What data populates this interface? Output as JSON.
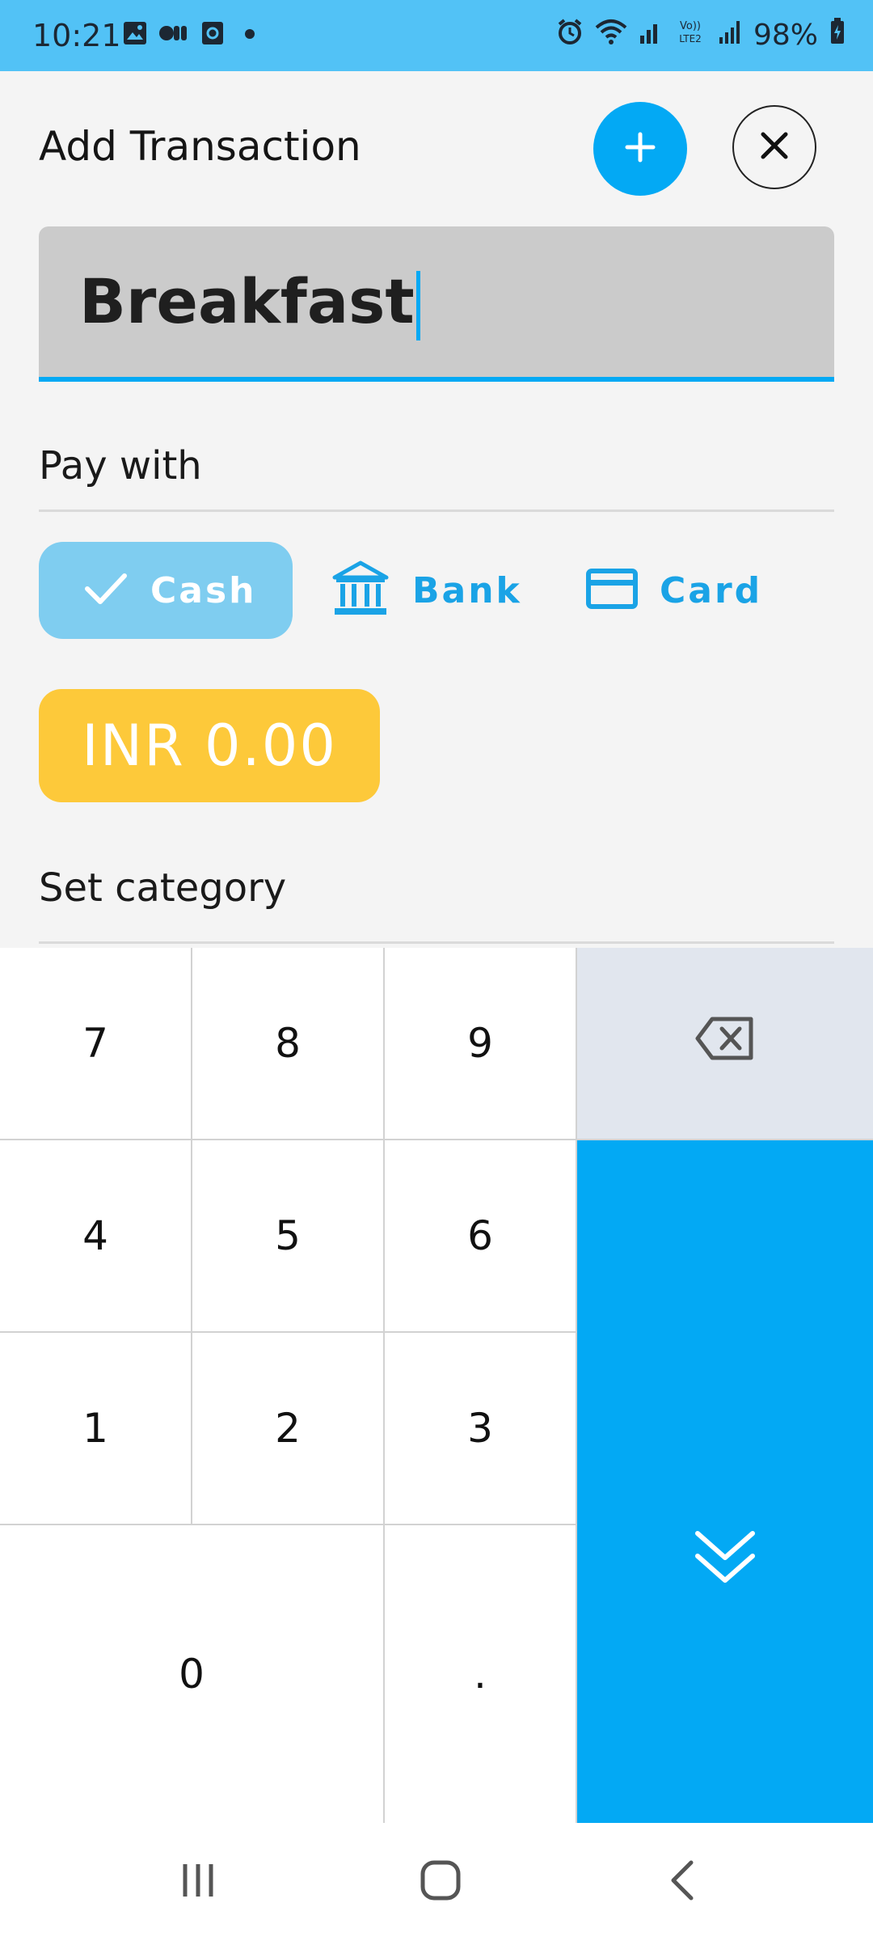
{
  "status_bar": {
    "time": "10:21",
    "battery": "98%",
    "left_icons": [
      "gallery-icon",
      "camera-icon",
      "app-icon",
      "dot-icon"
    ],
    "right_icons": [
      "alarm-icon",
      "wifi-icon",
      "signal-icon",
      "volte-icon",
      "signal-icon",
      "battery-icon"
    ]
  },
  "header": {
    "title": "Add Transaction",
    "add_icon": "plus-icon",
    "close_icon": "close-icon"
  },
  "input": {
    "value": "Breakfast"
  },
  "pay_with": {
    "label": "Pay with",
    "options": [
      {
        "label": "Cash",
        "icon": "check-icon",
        "selected": true
      },
      {
        "label": "Bank",
        "icon": "bank-icon",
        "selected": false
      },
      {
        "label": "Card",
        "icon": "card-icon",
        "selected": false
      }
    ]
  },
  "amount": {
    "text": "INR 0.00"
  },
  "category": {
    "label": "Set category"
  },
  "keypad": {
    "keys": [
      "7",
      "8",
      "9",
      "4",
      "5",
      "6",
      "1",
      "2",
      "3",
      "0",
      "."
    ],
    "backspace_icon": "backspace-icon",
    "done_icon": "double-chevron-down-icon"
  },
  "nav_bar": {
    "items": [
      "recents-icon",
      "home-icon",
      "back-icon"
    ]
  },
  "colors": {
    "status_bar": "#52c2f6",
    "accent": "#03a9f4",
    "amount_bg": "#fdc93a",
    "chip_selected": "#7fcdf0",
    "backspace_bg": "#e1e6ee"
  }
}
